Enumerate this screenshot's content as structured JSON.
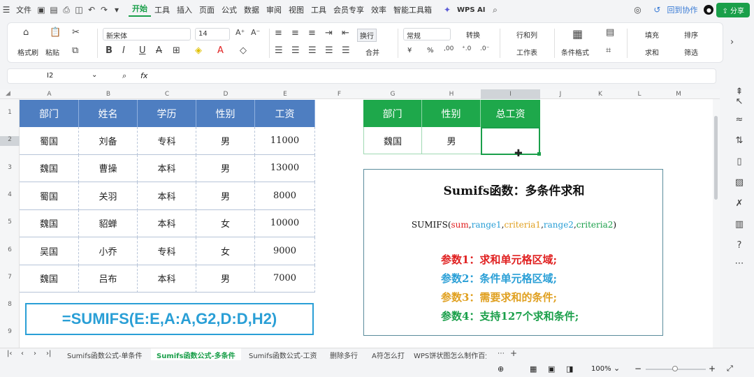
{
  "menubar": {
    "app_menu": "文件",
    "tabs": [
      "开始",
      "插入",
      "页面",
      "公式",
      "数据",
      "审阅",
      "视图",
      "工具",
      "会员专享",
      "效率",
      "智能工具箱"
    ],
    "tabs_partial": [
      "工具"
    ],
    "wps_ai": "WPS AI",
    "back_to_collab": "回到协作",
    "share": "分享"
  },
  "ribbon": {
    "format_painter": "格式刷",
    "paste": "粘贴",
    "font_name": "新宋体",
    "font_size": "14",
    "wrap": "换行",
    "merge": "合并",
    "number_format": "常规",
    "convert": "转换",
    "rows_cols": "行和列",
    "worksheet": "工作表",
    "cond_format": "条件格式",
    "fill": "填充",
    "sort": "排序",
    "sum": "求和",
    "filter": "筛选",
    "yuan": "¥",
    "percent": "%"
  },
  "formula_bar": {
    "name_box": "I2",
    "fx": "fx",
    "formula": ""
  },
  "columns": [
    "A",
    "B",
    "C",
    "D",
    "E",
    "F",
    "G",
    "H",
    "I",
    "J",
    "K",
    "L",
    "M"
  ],
  "rows": [
    "1",
    "2",
    "3",
    "4",
    "5",
    "6",
    "7",
    "8",
    "9"
  ],
  "table1": {
    "headers": [
      "部门",
      "姓名",
      "学历",
      "性别",
      "工资"
    ],
    "rows": [
      [
        "蜀国",
        "刘备",
        "专科",
        "男",
        "11000"
      ],
      [
        "魏国",
        "曹操",
        "本科",
        "男",
        "13000"
      ],
      [
        "蜀国",
        "关羽",
        "本科",
        "男",
        "8000"
      ],
      [
        "魏国",
        "貂蝉",
        "本科",
        "女",
        "10000"
      ],
      [
        "吴国",
        "小乔",
        "专科",
        "女",
        "9000"
      ],
      [
        "魏国",
        "吕布",
        "本科",
        "男",
        "7000"
      ]
    ]
  },
  "formula_box": "=SUMIFS(E:E,A:A,G2,D:D,H2)",
  "table2": {
    "headers": [
      "部门",
      "性别",
      "总工资"
    ],
    "row": [
      "魏国",
      "男",
      ""
    ]
  },
  "explain": {
    "title": "Sumifs函数：多条件求和",
    "syntax_fn": "SUMIFS(",
    "syntax_sum": "sum",
    "syntax_range1": "range1",
    "syntax_criteria1": "criteria1",
    "syntax_range2": "range2",
    "syntax_criteria2": "criteria2",
    "syntax_close": ")",
    "comma": ",",
    "p1": "参数1：求和单元格区域;",
    "p2": "参数2：条件单元格区域;",
    "p3": "参数3：需要求和的条件;",
    "p4": "参数4：支持127个求和条件;",
    "colors": {
      "p1": "#e02020",
      "p2": "#2a9fd6",
      "p3": "#e0a020",
      "p4": "#1a9f4a",
      "sum": "#e02020",
      "range": "#2a9fd6",
      "criteria": "#e0a020"
    }
  },
  "sheet_tabs": [
    "Sumifs函数公式-单条件",
    "Sumifs函数公式-多条件",
    "Sumifs函数公式-工资",
    "删除多行",
    "A符怎么打",
    "WPS饼状图怎么制作百分"
  ],
  "active_tab": "Sumifs函数公式-多条件",
  "status": {
    "zoom": "100%"
  }
}
